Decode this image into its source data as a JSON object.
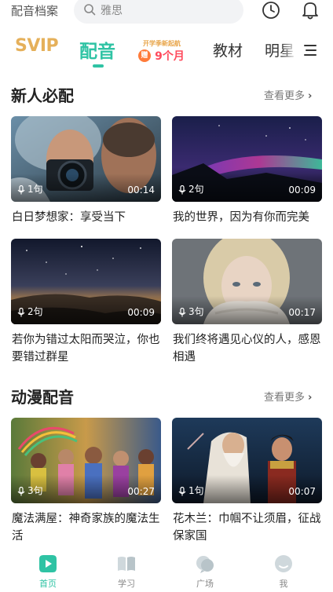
{
  "header": {
    "archive_label": "配音档案",
    "search_placeholder": "雅思"
  },
  "tabs": {
    "svip_label": "SVIP",
    "active_label": "配音",
    "promo_top": "开学季新起航",
    "promo_badge": "赠",
    "promo_main": "9个月",
    "textbook_label": "教材",
    "star_label": "明星"
  },
  "sections": [
    {
      "title": "新人必配",
      "more_label": "查看更多",
      "cards": [
        {
          "count": "1句",
          "duration": "00:14",
          "title": "白日梦想家：享受当下"
        },
        {
          "count": "2句",
          "duration": "00:09",
          "title": "我的世界，因为有你而完美"
        },
        {
          "count": "2句",
          "duration": "00:09",
          "title": "若你为错过太阳而哭泣，你也要错过群星"
        },
        {
          "count": "3句",
          "duration": "00:17",
          "title": "我们终将遇见心仪的人，感恩相遇"
        }
      ]
    },
    {
      "title": "动漫配音",
      "more_label": "查看更多",
      "cards": [
        {
          "count": "3句",
          "duration": "00:27",
          "title": "魔法满屋：神奇家族的魔法生活"
        },
        {
          "count": "1句",
          "duration": "00:07",
          "title": "花木兰：巾帼不让须眉，征战保家国"
        }
      ]
    }
  ],
  "bottom_nav": {
    "items": [
      {
        "label": "首页",
        "icon": "home-play-icon",
        "active": true
      },
      {
        "label": "学习",
        "icon": "book-icon",
        "active": false
      },
      {
        "label": "广场",
        "icon": "chat-bubble-icon",
        "active": false
      },
      {
        "label": "我",
        "icon": "profile-face-icon",
        "active": false
      }
    ]
  },
  "colors": {
    "accent": "#2fc3a4",
    "svip_gold": "#e5b05a",
    "promo_red": "#ff4a5c"
  }
}
